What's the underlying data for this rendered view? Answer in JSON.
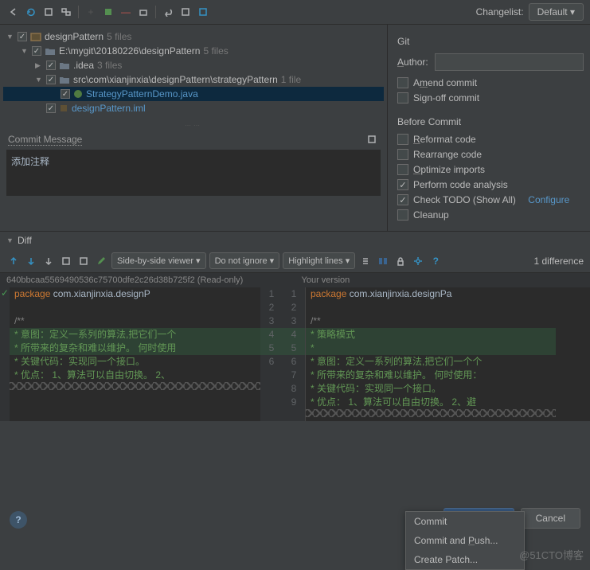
{
  "toolbar": {
    "changelist_label": "Changelist:",
    "changelist_value": "Default"
  },
  "tree": {
    "root": {
      "label": "designPattern",
      "count": "5 files"
    },
    "path": {
      "label": "E:\\mygit\\20180226\\designPattern",
      "count": "5 files"
    },
    "idea": {
      "label": ".idea",
      "count": "3 files"
    },
    "src": {
      "label": "src\\com\\xianjinxia\\designPattern\\strategyPattern",
      "count": "1 file"
    },
    "file1": "StrategyPatternDemo.java",
    "file2": "designPattern.iml"
  },
  "commit": {
    "label": "Commit Message",
    "text": "添加注释"
  },
  "git": {
    "header": "Git",
    "author_label": "Author:",
    "amend": "Amend commit",
    "signoff": "Sign-off commit"
  },
  "before": {
    "header": "Before Commit",
    "reformat": "Reformat code",
    "rearrange": "Rearrange code",
    "optimize": "Optimize imports",
    "analysis": "Perform code analysis",
    "todo": "Check TODO (Show All)",
    "configure": "Configure",
    "cleanup": "Cleanup"
  },
  "diff": {
    "label": "Diff",
    "viewer": "Side-by-side viewer ▾",
    "ignore": "Do not ignore ▾",
    "highlight": "Highlight lines ▾",
    "count": "1 difference",
    "left_title": "640bbcaa5569490536c75700dfe2c26d38b725f2 (Read-only)",
    "right_title": "Your version"
  },
  "code": {
    "left": {
      "l1": "package com.xianjinxia.designP",
      "l2": "",
      "l3": "/**",
      "l4": " * 意图：定义一系列的算法,把它们一个",
      "l5": " * 所带来的复杂和难以维护。  何时使用",
      "l6": " * 关键代码：实现同一个接口。",
      "l7": " * 优点：  1、算法可以自由切换。  2、"
    },
    "right": {
      "l1": "package com.xianjinxia.designPa",
      "l2": "",
      "l3": "/**",
      "l4": " * 策略模式",
      "l5": " *",
      "l6": " * 意图：定义一系列的算法,把它们一个个",
      "l7": " * 所带来的复杂和难以维护。  何时使用：",
      "l8": " * 关键代码：实现同一个接口。",
      "l9": " * 优点：  1、算法可以自由切换。  2、避"
    },
    "nums": {
      "n1": "1",
      "n2": "2",
      "n3": "3",
      "n4": "4",
      "n5": "5",
      "n6": "6",
      "n7": "7",
      "n8": "8",
      "n9": "9"
    }
  },
  "buttons": {
    "commit": "Commit ▾",
    "cancel": "Cancel"
  },
  "popup": {
    "i1": "Commit",
    "i2": "Commit and Push...",
    "i3": "Create Patch..."
  },
  "watermark": "@51CTO博客"
}
